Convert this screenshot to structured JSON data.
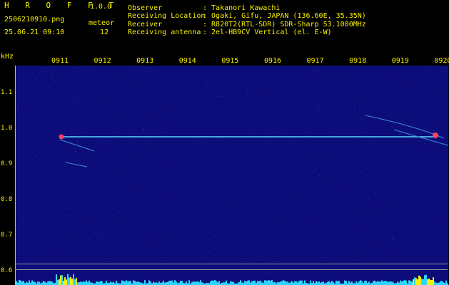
{
  "header": {
    "app_name": "H R O F F T",
    "version": "1.0.0",
    "filename": "2506210910.png",
    "timestamp": "25.06.21 09:10",
    "event_label": "meteor",
    "event_count": "12",
    "observer_label": "Observer",
    "observer_value": ": Takanori Kawachi",
    "location_label": "Receiving Location",
    "location_value": ": Ogaki, Gifu, JAPAN (136.60E, 35.35N)",
    "receiver_label": "Receiver",
    "receiver_value": ": R820T2(RTL-SDR) SDR-Sharp 53.1000MHz",
    "antenna_label": "Receiving antenna",
    "antenna_value": ": 2el-HB9CV Vertical (el. E-W)"
  },
  "axis": {
    "y_unit": "kHz",
    "x_ticks": [
      "0911",
      "0912",
      "0913",
      "0914",
      "0915",
      "0916",
      "0917",
      "0918",
      "0919",
      "0920"
    ],
    "y_ticks": [
      "1.1",
      "1.0",
      "0.9",
      "0.8",
      "0.7",
      "0.6"
    ]
  },
  "colors": {
    "header_yellow": "#f6f000",
    "header_green": "#39d44a",
    "background": "#0c0c7a",
    "carrier": "#5fd8ff",
    "meteor_echo": "#ff4060",
    "level_bars": "#2ad6ff",
    "level_peaks": "#f6f000"
  }
}
